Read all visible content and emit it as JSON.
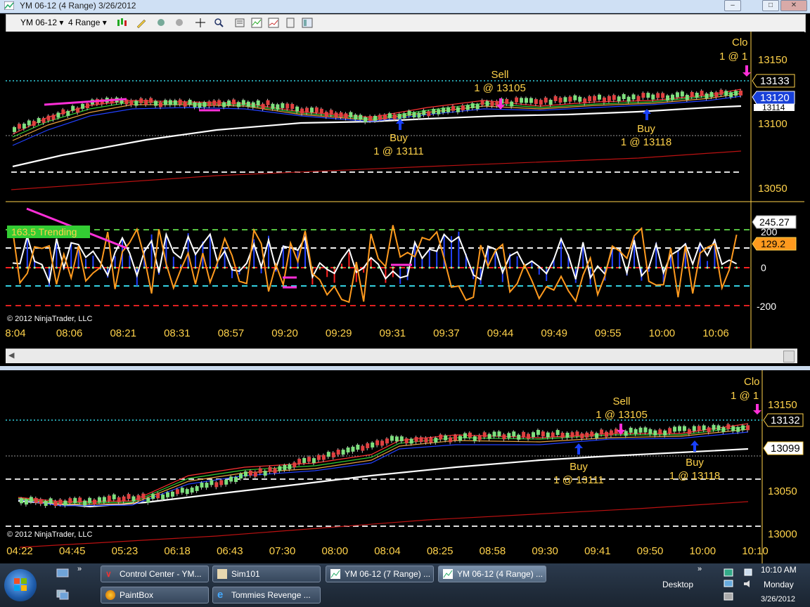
{
  "window": {
    "title": "YM 06-12 (4 Range)  3/26/2012"
  },
  "toolbar": {
    "instrument": "YM 06-12",
    "period": "4 Range"
  },
  "chart1": {
    "price_labels": [
      "13150",
      "13100",
      "13050"
    ],
    "price_tags": {
      "last": "13133",
      "mid": "13120",
      "under": "13114"
    },
    "osc_labels": [
      "200",
      "0",
      "-200"
    ],
    "osc_tags": {
      "a": "245.27",
      "b": "129.2"
    },
    "trend_label": "163.5 Trending",
    "copyright": "© 2012 NinjaTrader, LLC",
    "time_labels": [
      "8:04",
      "08:06",
      "08:21",
      "08:31",
      "08:57",
      "09:20",
      "09:29",
      "09:31",
      "09:37",
      "09:44",
      "09:49",
      "09:55",
      "10:00",
      "10:06"
    ],
    "trades": {
      "sell_title": "Sell",
      "sell_detail": "1 @ 13105",
      "buy1_title": "Buy",
      "buy1_detail": "1 @ 13111",
      "buy2_title": "Buy",
      "buy2_detail": "1 @ 13118",
      "close_title": "Clo",
      "close_detail": "1 @ 1"
    }
  },
  "chart2": {
    "price_labels": [
      "13150",
      "13050",
      "13000"
    ],
    "price_tags": {
      "last": "13132",
      "ma": "13099"
    },
    "copyright": "© 2012 NinjaTrader, LLC",
    "time_labels": [
      "04:22",
      "04:45",
      "05:23",
      "06:18",
      "06:43",
      "07:30",
      "08:00",
      "08:04",
      "08:25",
      "08:58",
      "09:30",
      "09:41",
      "09:50",
      "10:00",
      "10:10"
    ],
    "trades": {
      "sell_title": "Sell",
      "sell_detail": "1 @ 13105",
      "buy1_title": "Buy",
      "buy1_detail": "1 @ 13111",
      "buy2_title": "Buy",
      "buy2_detail": "1 @ 13118",
      "close_title": "Clo",
      "close_detail": "1 @ 1"
    }
  },
  "taskbar": {
    "tasks": [
      "Control Center - YM...",
      "Sim101",
      "YM 06-12 (7 Range) ...",
      "YM 06-12 (4 Range) ...",
      "PaintBox",
      "Tommies Revenge ..."
    ],
    "desktop": "Desktop",
    "time": "10:10 AM",
    "day": "Monday",
    "date": "3/26/2012"
  },
  "colors": {
    "price_text": "#ffd24a",
    "up_bar": "#7ee07e",
    "down_bar": "#e04040",
    "ma_slow": "#ffffff",
    "osc_orange": "#ff9a1e",
    "marker_magenta": "#ff2fd8"
  }
}
